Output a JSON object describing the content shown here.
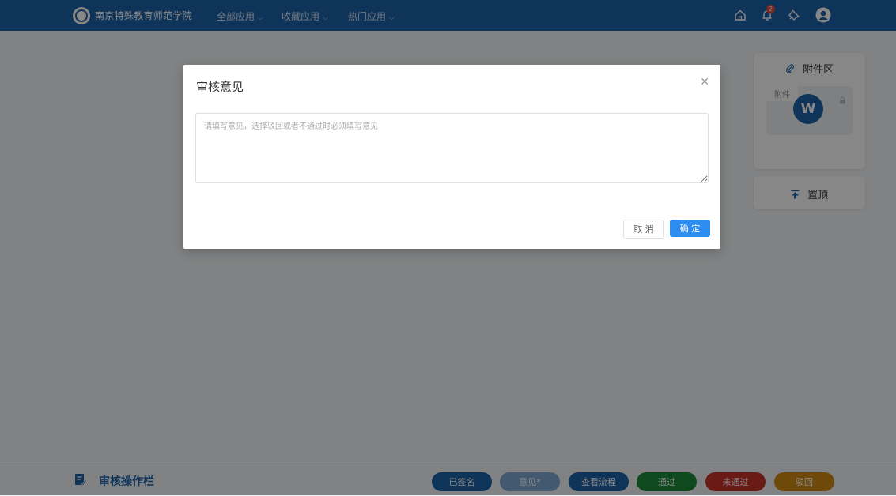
{
  "header": {
    "school_name": "南京特殊教育师范学院",
    "menus": [
      {
        "label": "全部应用"
      },
      {
        "label": "收藏应用"
      },
      {
        "label": "热门应用"
      }
    ],
    "notification_count": "2"
  },
  "side": {
    "attachment_title": "附件区",
    "attachment_tag": "附件",
    "attachment_file_letter": "W",
    "pin_label": "置顶"
  },
  "bottom": {
    "title": "审核操作栏",
    "buttons": [
      {
        "label": "已签名",
        "color": "#1e63a8"
      },
      {
        "label": "意见*",
        "color": "#7fa8d4"
      },
      {
        "label": "查看流程",
        "color": "#1e63a8"
      },
      {
        "label": "通过",
        "color": "#1e8a3a"
      },
      {
        "label": "未通过",
        "color": "#c8332b"
      },
      {
        "label": "驳回",
        "color": "#d08a12"
      }
    ]
  },
  "dialog": {
    "title": "审核意见",
    "placeholder": "请填写意见，选择驳回或者不通过时必须填写意见",
    "cancel_label": "取 消",
    "confirm_label": "确 定"
  },
  "colors": {
    "header_bg": "#1e63a8",
    "primary": "#2d8cf0"
  }
}
